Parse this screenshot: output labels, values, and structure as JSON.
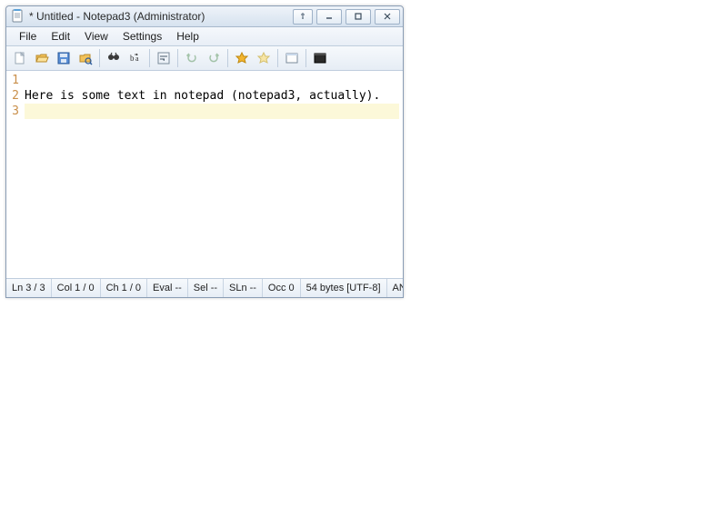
{
  "title": "* Untitled - Notepad3 (Administrator)",
  "menu": {
    "file": "File",
    "edit": "Edit",
    "view": "View",
    "settings": "Settings",
    "help": "Help"
  },
  "toolbar": {
    "new": "new",
    "open": "open",
    "save": "save",
    "browse": "browse",
    "find": "find",
    "replace": "replace",
    "wordwrap": "wordwrap",
    "undo": "undo",
    "redo": "redo",
    "fav_add": "fav_add",
    "fav_open": "fav_open",
    "zoom": "zoom",
    "scheme": "scheme"
  },
  "lines": [
    {
      "num": "1",
      "text": ""
    },
    {
      "num": "2",
      "text": "Here is some text in notepad (notepad3, actually)."
    },
    {
      "num": "3",
      "text": ""
    }
  ],
  "current_line": 3,
  "status": {
    "ln": {
      "k": "Ln",
      "v": "3 / 3"
    },
    "col": {
      "k": "Col",
      "v": "1 / 0"
    },
    "ch": {
      "k": "Ch",
      "v": "1 / 0"
    },
    "eval": {
      "k": "Eval",
      "v": "--"
    },
    "sel": {
      "k": "Sel",
      "v": "--"
    },
    "sln": {
      "k": "SLn",
      "v": "--"
    },
    "occ": {
      "k": "Occ",
      "v": "0"
    },
    "size": "54 bytes [UTF-8]",
    "enc": "AN"
  }
}
